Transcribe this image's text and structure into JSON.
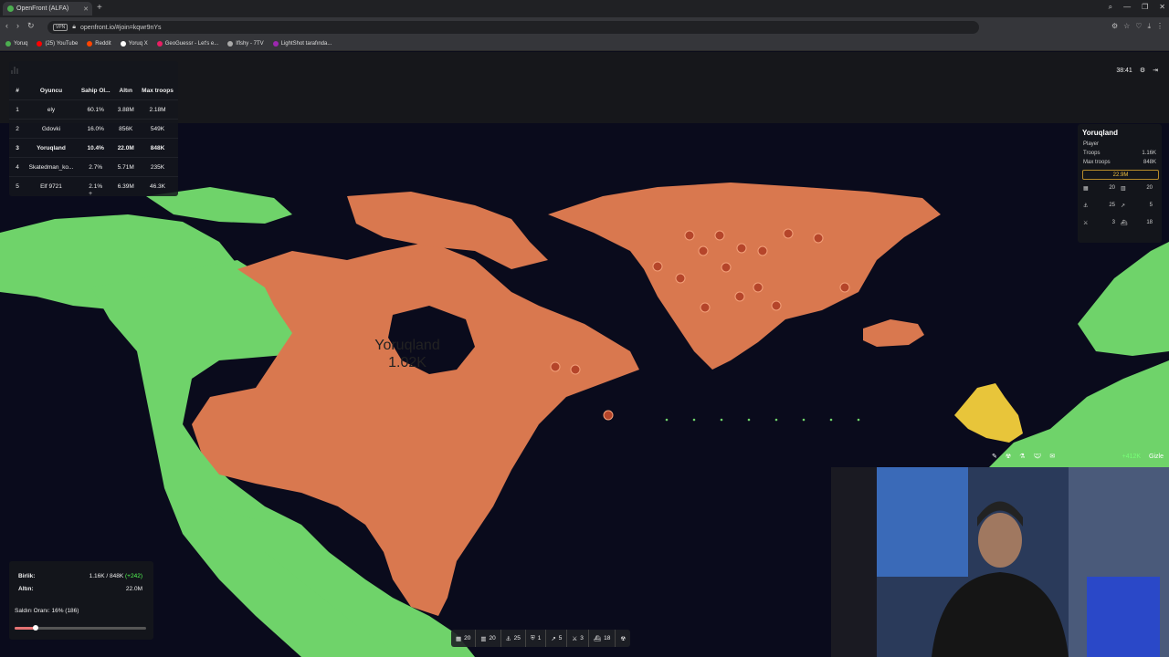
{
  "browser": {
    "tab_title": "OpenFront (ALFA)",
    "url": "openfront.io/#join=kqwr9nYs",
    "vpn_label": "VPN",
    "bookmarks": [
      {
        "label": "Yoruq",
        "color": "#4caf50"
      },
      {
        "label": "(25) YouTube",
        "color": "#ff0000"
      },
      {
        "label": "Reddit",
        "color": "#ff4500"
      },
      {
        "label": "Yoruq X",
        "color": "#ffffff"
      },
      {
        "label": "GeoGuessr - Let's e...",
        "color": "#e91e63"
      },
      {
        "label": "Iflshy - 7TV",
        "color": "#aaaaaa"
      },
      {
        "label": "LightShot tarafında...",
        "color": "#9c27b0"
      }
    ]
  },
  "leaderboard": {
    "headers": [
      "#",
      "Oyuncu",
      "Sahip Ol...",
      "Altın",
      "Max troops"
    ],
    "rows": [
      {
        "rank": "1",
        "player": "ely",
        "owned": "60.1%",
        "gold": "3.88M",
        "troops": "2.18M"
      },
      {
        "rank": "2",
        "player": "Gdovki",
        "owned": "16.0%",
        "gold": "856K",
        "troops": "549K"
      },
      {
        "rank": "3",
        "player": "Yoruqland",
        "owned": "10.4%",
        "gold": "22.0M",
        "troops": "848K"
      },
      {
        "rank": "4",
        "player": "Skatedman_ko...",
        "owned": "2.7%",
        "gold": "5.71M",
        "troops": "235K"
      },
      {
        "rank": "5",
        "player": "Elf 9721",
        "owned": "2.1%",
        "gold": "6.39M",
        "troops": "46.3K"
      }
    ],
    "expand_label": "+"
  },
  "timer": "38:41",
  "player_info": {
    "name": "Yoruqland",
    "role": "Player",
    "troops_label": "Troops",
    "troops_value": "1.16K",
    "max_troops_label": "Max troops",
    "max_troops_value": "848K",
    "gold": "22.9M",
    "buildings": [
      "20",
      "20",
      "25",
      "5",
      "3",
      "18"
    ]
  },
  "map_label": {
    "name": "Yoruqland",
    "troops": "1.02K"
  },
  "stats": {
    "units_label": "Birlik:",
    "units_value": "1.16K / 848K",
    "units_gain": "(+242)",
    "gold_label": "Altın:",
    "gold_value": "22.0M",
    "attack_ratio_label": "Saldırı Oranı: 16% (186)",
    "attack_ratio": 0.16
  },
  "toolbar": [
    "20",
    "20",
    "25",
    "1",
    "5",
    "3",
    "18"
  ],
  "action_bar": {
    "gain": "+412K",
    "hide_label": "Gizle"
  },
  "colors": {
    "self": "#d9784f",
    "ally": "#6fd36a",
    "gold_yellow": "#e8c53a"
  }
}
